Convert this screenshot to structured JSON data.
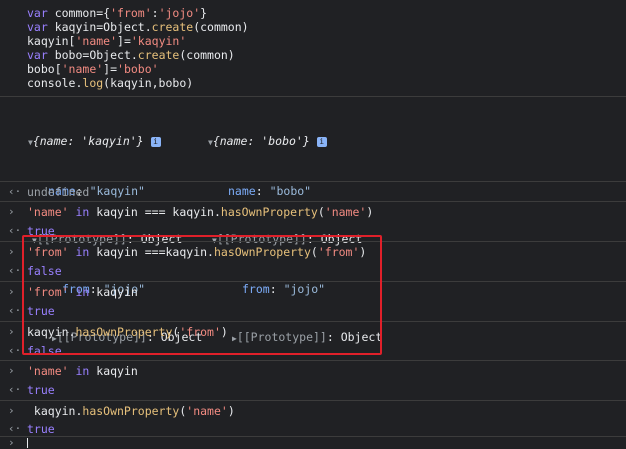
{
  "source_lines": [
    "var common={'from':'jojo'}",
    "var kaqyin=Object.create(common)",
    "kaqyin['name']='kaqyin'",
    "var bobo=Object.create(common)",
    "bobo['name']='bobo'",
    "console.log(kaqyin,bobo)"
  ],
  "log_output": {
    "obj1": {
      "summary": "{name: 'kaqyin'}",
      "name_key": "name",
      "name_val": "\"kaqyin\"",
      "proto_label": "[[Prototype]]",
      "proto_type": "Object",
      "from_key": "from",
      "from_val": "\"jojo\"",
      "proto2_label": "[[Prototype]]",
      "proto2_type": "Object"
    },
    "obj2": {
      "summary": "{name: 'bobo'}",
      "name_key": "name",
      "name_val": "\"bobo\"",
      "proto_label": "[[Prototype]]",
      "proto_type": "Object",
      "from_key": "from",
      "from_val": "\"jojo\"",
      "proto2_label": "[[Prototype]]",
      "proto2_type": "Object"
    }
  },
  "entries": [
    {
      "kind": "result",
      "text": "undefined"
    },
    {
      "kind": "input",
      "text": "'name' in kaqyin === kaqyin.hasOwnProperty('name')"
    },
    {
      "kind": "result",
      "text": "true"
    },
    {
      "kind": "input",
      "text": "'from' in kaqyin ===kaqyin.hasOwnProperty('from')"
    },
    {
      "kind": "result",
      "text": "false"
    },
    {
      "kind": "input",
      "text": "'from' in kaqyin"
    },
    {
      "kind": "result",
      "text": "true"
    },
    {
      "kind": "input",
      "text": "kaqyin.hasOwnProperty('from')"
    },
    {
      "kind": "result",
      "text": "false"
    },
    {
      "kind": "input",
      "text": "'name' in kaqyin"
    },
    {
      "kind": "result",
      "text": "true"
    },
    {
      "kind": "input",
      "text": " kaqyin.hasOwnProperty('name')"
    },
    {
      "kind": "result",
      "text": "true"
    }
  ],
  "icons": {
    "prompt": "chevron-right-icon",
    "result": "return-arrow-icon",
    "info": "info-icon",
    "expand": "triangle-right-icon",
    "collapse": "triangle-down-icon"
  },
  "colors": {
    "background": "#202124",
    "keyword": "#9980ff",
    "string": "#f28b82",
    "highlight_border": "#e0202a"
  }
}
